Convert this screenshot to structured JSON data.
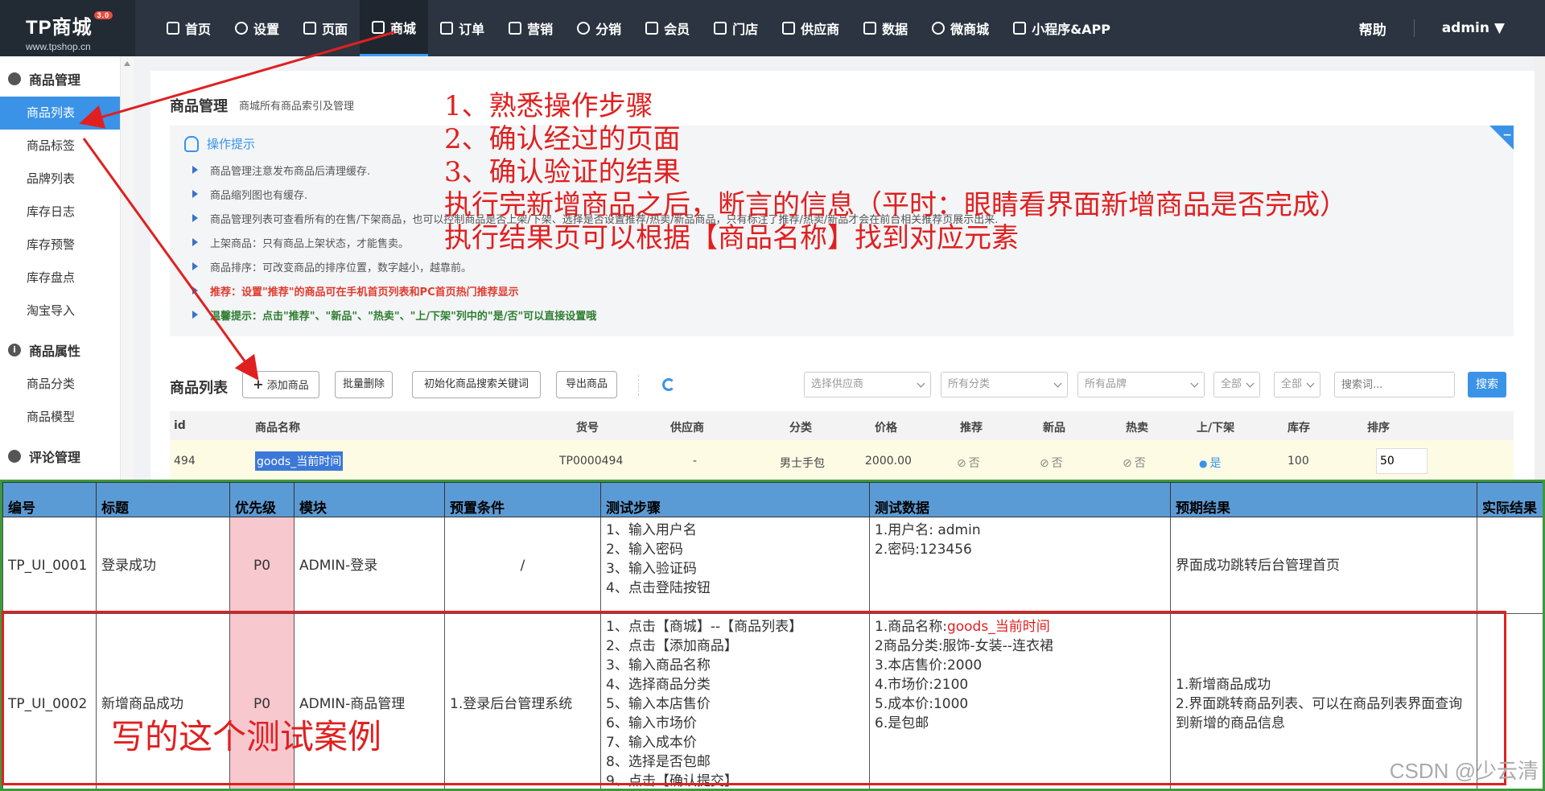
{
  "logo": {
    "name": "TP商城",
    "version": "3.0",
    "url": "www.tpshop.cn"
  },
  "nav": {
    "items": [
      "首页",
      "设置",
      "页面",
      "商城",
      "订单",
      "营销",
      "分销",
      "会员",
      "门店",
      "供应商",
      "数据",
      "微商城",
      "小程序&APP"
    ],
    "active": "商城",
    "help": "帮助",
    "user": "admin"
  },
  "sidebar": {
    "groups": [
      {
        "title": "商品管理",
        "items": [
          "商品列表",
          "商品标签",
          "品牌列表",
          "库存日志",
          "库存预警",
          "库存盘点",
          "淘宝导入"
        ]
      },
      {
        "title": "商品属性",
        "items": [
          "商品分类",
          "商品模型"
        ]
      },
      {
        "title": "评论管理",
        "items": []
      }
    ],
    "active_item": "商品列表"
  },
  "page": {
    "title": "商品管理",
    "subtitle": "商城所有商品索引及管理",
    "tips_title": "操作提示",
    "tips": [
      "商品管理注意发布商品后清理缓存.",
      "商品缩列图也有缓存.",
      "商品管理列表可查看所有的在售/下架商品，也可以控制商品是否上架/下架、选择是否设置推荐/热卖/新品商品，只有标注了推荐/热卖/新品才会在前台相关推荐页展示出来.",
      "上架商品：只有商品上架状态，才能售卖。",
      "商品排序：可改变商品的排序位置，数字越小，越靠前。",
      "推荐：设置\"推荐\"的商品可在手机首页列表和PC首页热门推荐显示",
      "温馨提示：点击\"推荐\"、\"新品\"、\"热卖\"、\"上/下架\"列中的\"是/否\"可以直接设置哦"
    ]
  },
  "toolbar": {
    "list_title": "商品列表",
    "add": "添加商品",
    "batch_delete": "批量删除",
    "init_keywords": "初始化商品搜索关键词",
    "export": "导出商品",
    "supplier_placeholder": "选择供应商",
    "category_placeholder": "所有分类",
    "brand_placeholder": "所有品牌",
    "all1": "全部",
    "all2": "全部",
    "search_placeholder": "搜索词...",
    "search": "搜索"
  },
  "table": {
    "headers": [
      "id",
      "商品名称",
      "货号",
      "供应商",
      "分类",
      "价格",
      "推荐",
      "新品",
      "热卖",
      "上/下架",
      "库存",
      "排序"
    ],
    "row": {
      "id": "494",
      "name": "goods_当前时间",
      "sn": "TP0000494",
      "supplier": "-",
      "category": "男士手包",
      "price": "2000.00",
      "recommend": "否",
      "new": "否",
      "hot": "否",
      "on_sale": "是",
      "stock": "100",
      "sort": "50"
    }
  },
  "annotations": {
    "lines": [
      "1、熟悉操作步骤",
      "2、确认经过的页面",
      "3、确认验证的结果",
      "执行完新增商品之后，断言的信息（平时：眼睛看界面新增商品是否完成）",
      "执行结果页可以根据【商品名称】找到对应元素"
    ],
    "case_note": "写的这个测试案例"
  },
  "testcases": {
    "headers": [
      "编号",
      "标题",
      "优先级",
      "模块",
      "预置条件",
      "测试步骤",
      "测试数据",
      "预期结果",
      "实际结果"
    ],
    "rows": [
      {
        "id": "TP_UI_0001",
        "title": "登录成功",
        "priority": "P0",
        "module": "ADMIN-登录",
        "precondition": "/",
        "steps": [
          "1、输入用户名",
          "2、输入密码",
          "3、输入验证码",
          "4、点击登陆按钮"
        ],
        "data": [
          "1.用户名: admin",
          "2.密码:123456"
        ],
        "expected": "界面成功跳转后台管理首页"
      },
      {
        "id": "TP_UI_0002",
        "title": "新增商品成功",
        "priority": "P0",
        "module": "ADMIN-商品管理",
        "precondition": "1.登录后台管理系统",
        "steps": [
          "1、点击【商城】--【商品列表】",
          "2、点击【添加商品】",
          "3、输入商品名称",
          "4、选择商品分类",
          "5、输入本店售价",
          "6、输入市场价",
          "7、输入成本价",
          "8、选择是否包邮",
          "9、点击【确认提交】"
        ],
        "data_name_label": "1.商品名称:",
        "data_name_value": "goods_当前时间",
        "data": [
          "2商品分类:服饰-女装--连衣裙",
          "3.本店售价:2000",
          "4.市场价:2100",
          "5.成本价:1000",
          "6.是包邮"
        ],
        "expected_lines": [
          "1.新增商品成功",
          "2.界面跳转商品列表、可以在商品列表界面查询到新增的商品信息"
        ]
      }
    ]
  },
  "watermark": "CSDN @少云清",
  "colors": {
    "topbar": "#2b3440",
    "accent": "#3b93e8",
    "annotation": "#e02020",
    "priority_bg": "#f8c8cf",
    "header_bg": "#5b9bd5"
  }
}
